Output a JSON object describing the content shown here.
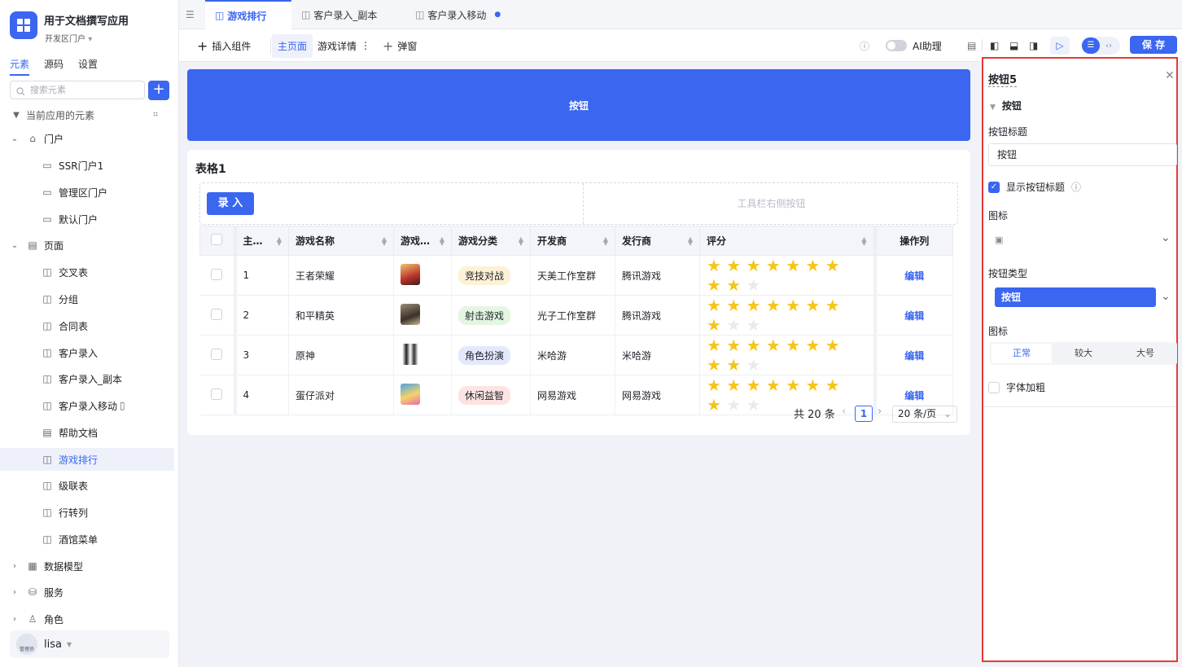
{
  "app": {
    "title": "用于文档撰写应用",
    "subtitle": "开发区门户"
  },
  "sidebar": {
    "tabs": [
      "元素",
      "源码",
      "设置"
    ],
    "search_placeholder": "搜索元素",
    "section_label": "当前应用的元素",
    "items": [
      {
        "label": "门户"
      },
      {
        "label": "SSR门户1"
      },
      {
        "label": "管理区门户"
      },
      {
        "label": "默认门户"
      },
      {
        "label": "页面"
      },
      {
        "label": "交叉表"
      },
      {
        "label": "分组"
      },
      {
        "label": "合同表"
      },
      {
        "label": "客户录入"
      },
      {
        "label": "客户录入_副本"
      },
      {
        "label": "客户录入移动"
      },
      {
        "label": "帮助文档"
      },
      {
        "label": "游戏排行"
      },
      {
        "label": "级联表"
      },
      {
        "label": "行转列"
      },
      {
        "label": "酒馆菜单"
      },
      {
        "label": "数据模型"
      },
      {
        "label": "服务"
      },
      {
        "label": "角色"
      }
    ],
    "user": {
      "name": "lisa",
      "role": "管理员"
    }
  },
  "tabs": [
    {
      "label": "游戏排行"
    },
    {
      "label": "客户录入_副本"
    },
    {
      "label": "客户录入移动"
    }
  ],
  "toolbar": {
    "insert": "插入组件",
    "main_page": "主页面",
    "details": "游戏详情",
    "popup": "弹窗",
    "ai": "AI助理",
    "save": "保 存"
  },
  "canvas": {
    "big_button": "按钮",
    "table_title": "表格1",
    "entry_button": "录 入",
    "toolbar_right": "工具栏右侧按钮",
    "headers": [
      "主…",
      "游戏名称",
      "游戏…",
      "游戏分类",
      "开发商",
      "发行商",
      "评分",
      "操作列"
    ],
    "rows": [
      {
        "id": "1",
        "name": "王者荣耀",
        "category": "竞技对战",
        "developer": "天美工作室群",
        "publisher": "腾讯游戏",
        "rating": 9,
        "action": "编辑"
      },
      {
        "id": "2",
        "name": "和平精英",
        "category": "射击游戏",
        "developer": "光子工作室群",
        "publisher": "腾讯游戏",
        "rating": 8,
        "action": "编辑"
      },
      {
        "id": "3",
        "name": "原神",
        "category": "角色扮演",
        "developer": "米哈游",
        "publisher": "米哈游",
        "rating": 9,
        "action": "编辑"
      },
      {
        "id": "4",
        "name": "蛋仔派对",
        "category": "休闲益智",
        "developer": "网易游戏",
        "publisher": "网易游戏",
        "rating": 8,
        "action": "编辑"
      }
    ],
    "tag_colors": [
      "#fdf1d6",
      "#e3f6e1",
      "#e4e8fb",
      "#fde3e1"
    ],
    "total": "共 20 条",
    "page": "1",
    "page_size": "20 条/页"
  },
  "panel": {
    "title": "按钮5",
    "section": "按钮",
    "label_title": "按钮标题",
    "title_value": "按钮",
    "show_title": "显示按钮标题",
    "icon_label": "图标",
    "type_label": "按钮类型",
    "type_value": "按钮",
    "size_label": "图标",
    "sizes": [
      "正常",
      "较大",
      "大号"
    ],
    "bold_label": "字体加粗"
  },
  "colors": {
    "accent": "#3a66f0",
    "highlight": "#e53935",
    "star": "#f5c518"
  }
}
